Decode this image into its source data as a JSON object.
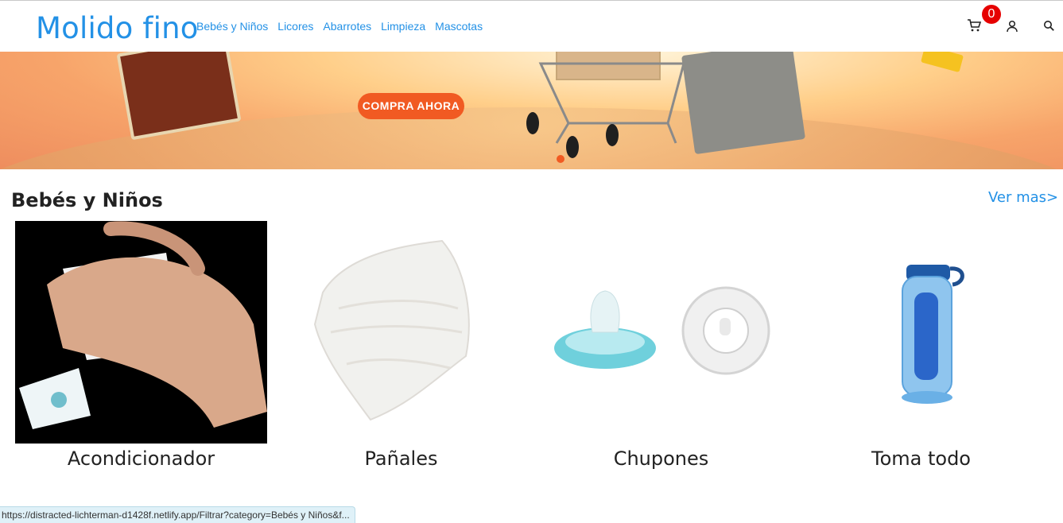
{
  "nav": {
    "brand": "Molido fino",
    "links": [
      "Bebés y Niños",
      "Licores",
      "Abarrotes",
      "Limpieza",
      "Mascotas"
    ],
    "cart_count": "0",
    "icons": [
      "cart-icon",
      "user-icon",
      "search-icon"
    ]
  },
  "banner": {
    "cta_label": "COMPRA AHORA"
  },
  "section": {
    "title": "Bebés y Niños",
    "see_more": "Ver mas>"
  },
  "products": [
    {
      "name": "Acondicionador"
    },
    {
      "name": "Pañales"
    },
    {
      "name": "Chupones"
    },
    {
      "name": "Toma todo"
    }
  ],
  "status": {
    "url": "https://distracted-lichterman-d1428f.netlify.app/Filtrar?category=Bebés y Niños&f..."
  },
  "colors": {
    "brand": "#2391e6",
    "badge": "#e60000",
    "cta": "#f15a22"
  }
}
